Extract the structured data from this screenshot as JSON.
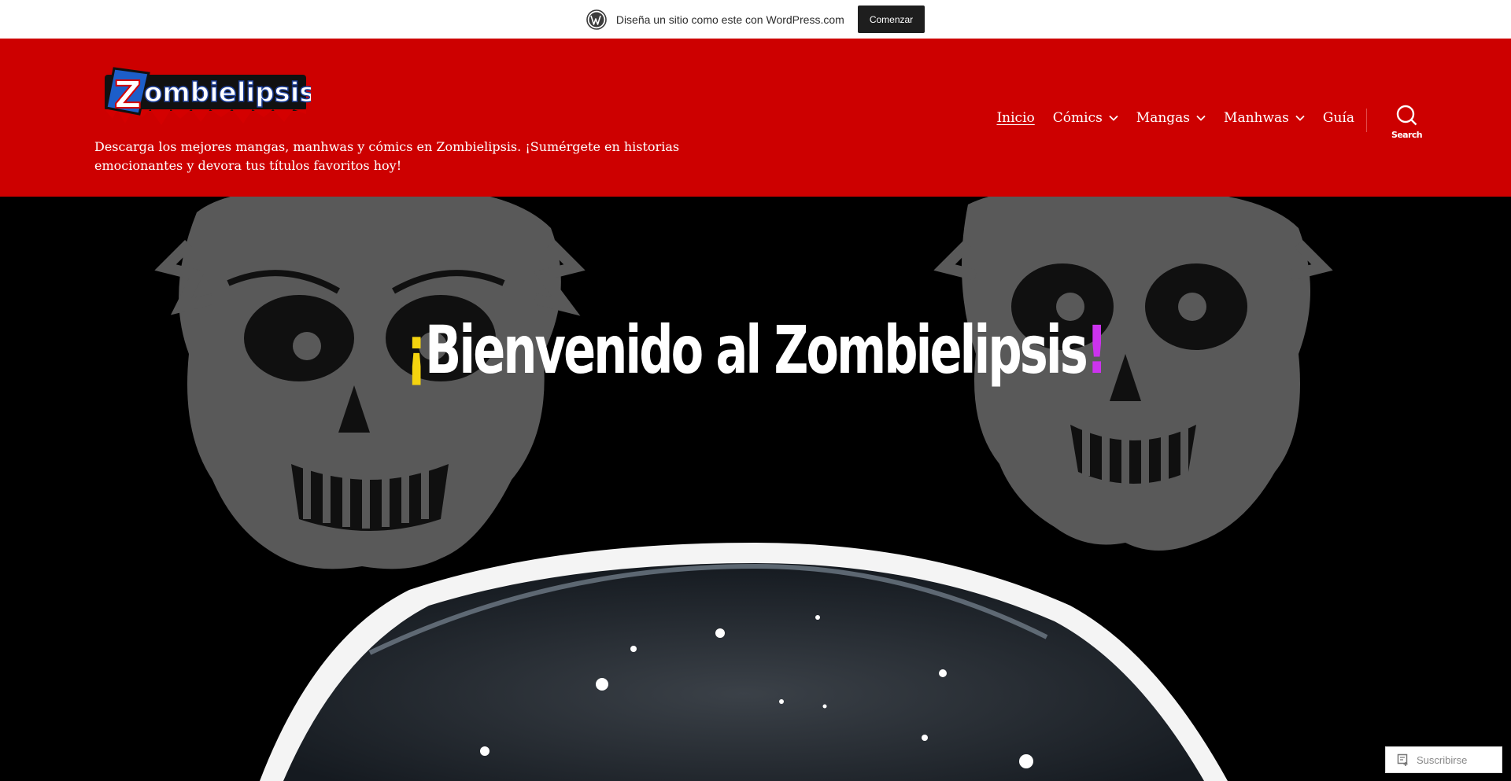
{
  "promo": {
    "text": "Diseña un sitio como este con WordPress.com",
    "button": "Comenzar"
  },
  "header": {
    "logo_text": "Zombielipsis",
    "tagline": "Descarga los mejores mangas, manhwas y cómics en Zombielipsis. ¡Sumérgete en historias emocionantes y devora tus títulos favoritos hoy!",
    "nav": [
      {
        "label": "Inicio",
        "active": true,
        "has_submenu": false
      },
      {
        "label": "Cómics",
        "active": false,
        "has_submenu": true
      },
      {
        "label": "Mangas",
        "active": false,
        "has_submenu": true
      },
      {
        "label": "Manhwas",
        "active": false,
        "has_submenu": true
      },
      {
        "label": "Guía",
        "active": false,
        "has_submenu": false
      }
    ],
    "search_label": "Search"
  },
  "hero": {
    "title_open": "¡",
    "title_main": "Bienvenido al Zombielipsis",
    "title_close": "!"
  },
  "subscribe": {
    "label": "Suscribirse"
  },
  "colors": {
    "header_bg": "#cd0000",
    "open_excl": "#f5d40f",
    "close_excl": "#cc33ee"
  }
}
